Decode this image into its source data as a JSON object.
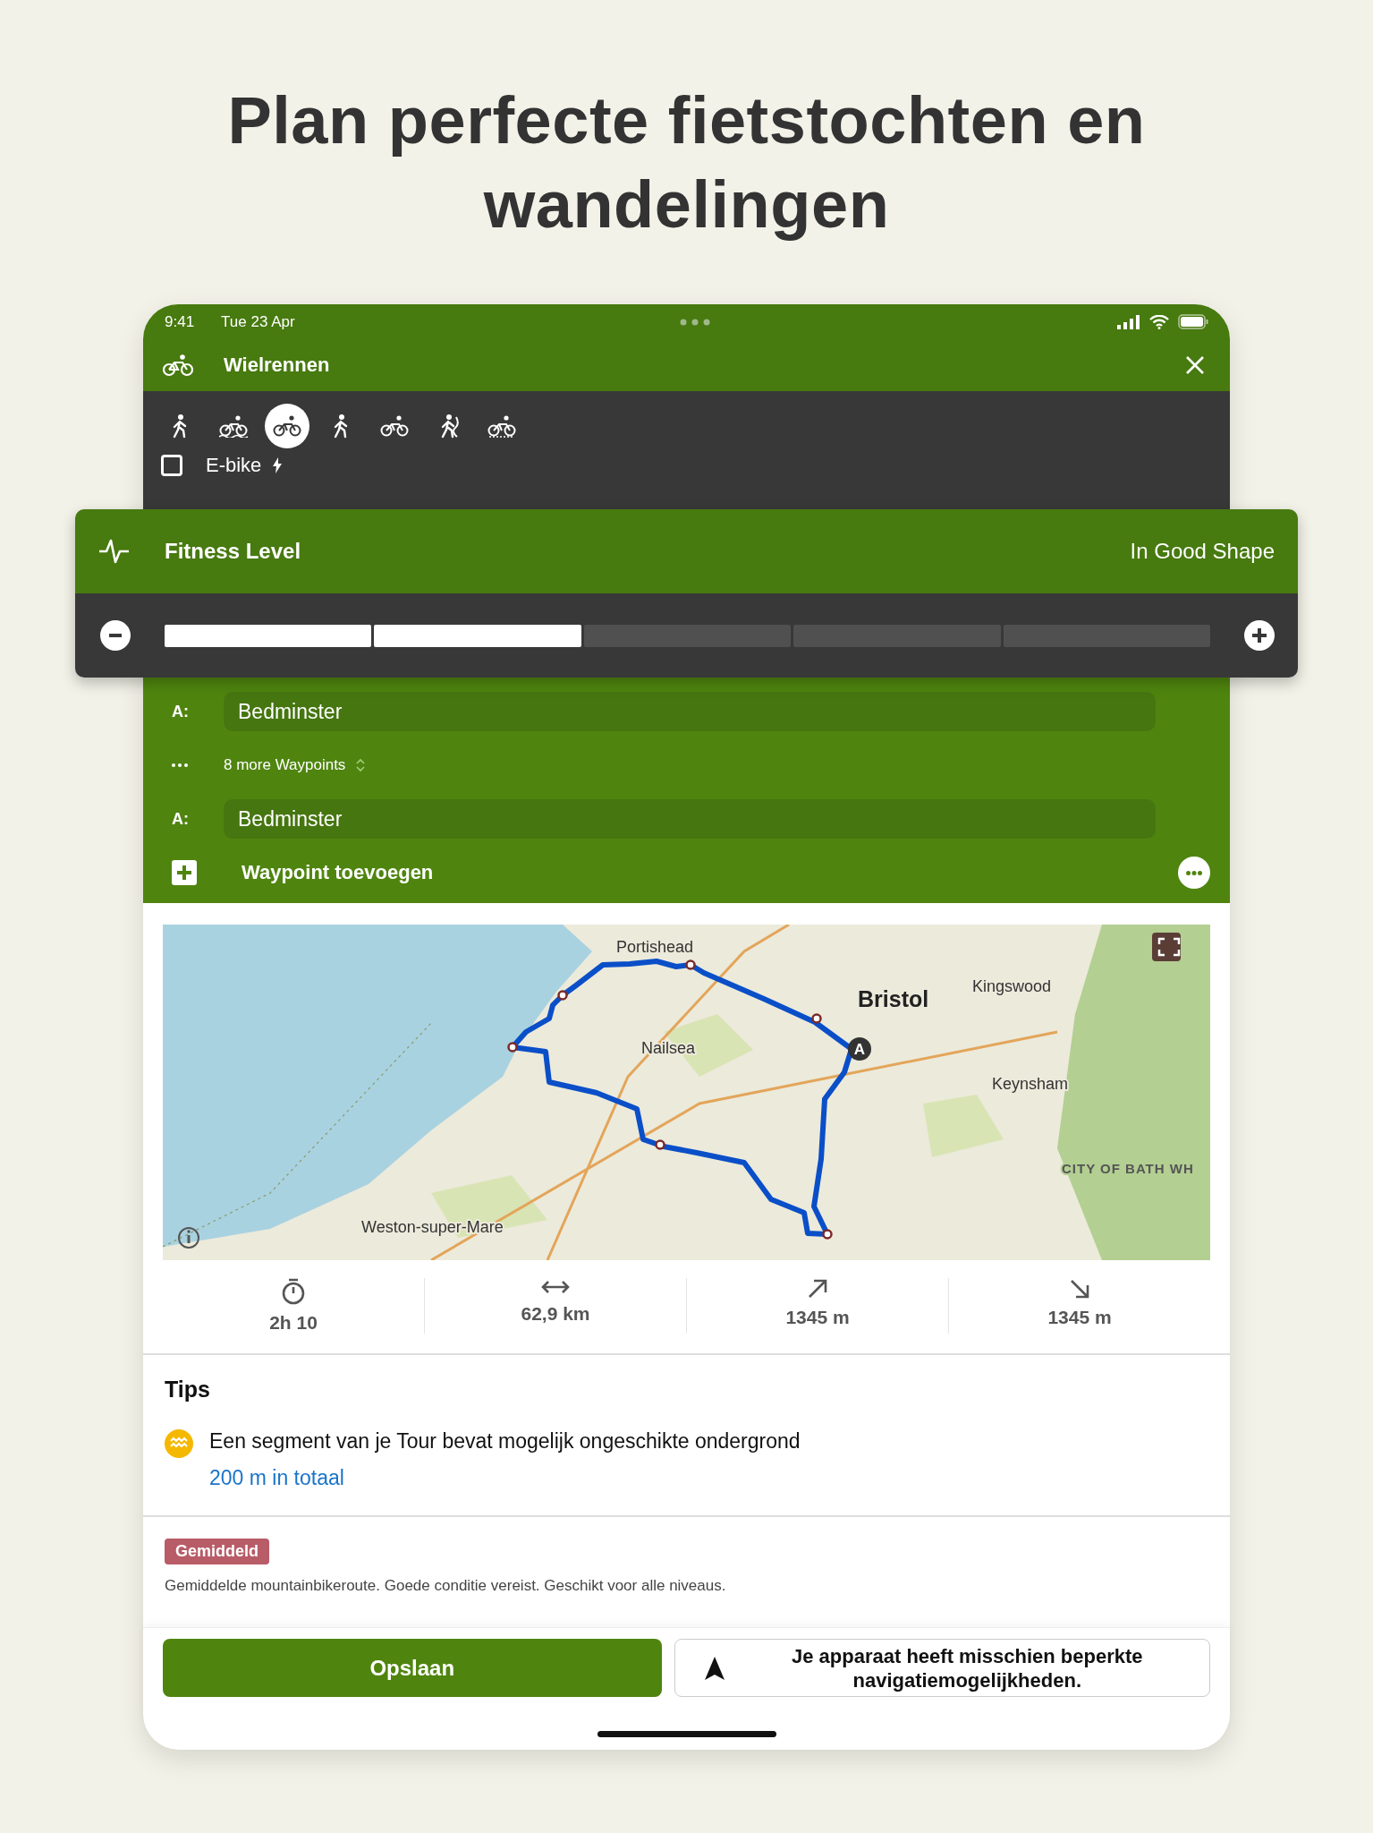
{
  "headline": "Plan perfecte fietstochten en wandelingen",
  "status_bar": {
    "time": "9:41",
    "date": "Tue 23 Apr"
  },
  "header": {
    "title": "Wielrennen"
  },
  "sports": [
    {
      "kind": "hiking",
      "selected": false
    },
    {
      "kind": "mtb",
      "selected": false
    },
    {
      "kind": "road",
      "selected": true
    },
    {
      "kind": "running",
      "selected": false
    },
    {
      "kind": "touring",
      "selected": false
    },
    {
      "kind": "mountaineering",
      "selected": false
    },
    {
      "kind": "gravel",
      "selected": false
    }
  ],
  "ebike": {
    "label": "E-bike",
    "checked": false
  },
  "fitness": {
    "title": "Fitness Level",
    "value": "In Good Shape",
    "level": 0.4
  },
  "waypoints": [
    {
      "kind": "stop",
      "label": "A:",
      "value": "Bedminster"
    },
    {
      "kind": "more",
      "value": "8 more Waypoints"
    },
    {
      "kind": "stop",
      "label": "A:",
      "value": "Bedminster"
    }
  ],
  "add_waypoint": "Waypoint toevoegen",
  "map": {
    "marker": "A",
    "labels": [
      {
        "kind": "town",
        "text": "Portishead"
      },
      {
        "kind": "city",
        "text": "Bristol"
      },
      {
        "kind": "town",
        "text": "Kingswood"
      },
      {
        "kind": "town",
        "text": "Nailsea"
      },
      {
        "kind": "town",
        "text": "Keynsham"
      },
      {
        "kind": "region",
        "text": "CITY OF BATH WH"
      },
      {
        "kind": "town",
        "text": "Weston-super-Mare"
      }
    ]
  },
  "stats": [
    {
      "kind": "duration",
      "value": "2h 10"
    },
    {
      "kind": "distance",
      "value": "62,9 km"
    },
    {
      "kind": "ascent",
      "value": "1345 m"
    },
    {
      "kind": "descent",
      "value": "1345 m"
    }
  ],
  "tips": {
    "title": "Tips",
    "items": [
      {
        "text": "Een segment van je Tour bevat mogelijk ongeschikte ondergrond",
        "link": "200 m in totaal"
      }
    ]
  },
  "difficulty": {
    "badge": "Gemiddeld",
    "description": "Gemiddelde mountainbikeroute. Goede conditie vereist. Geschikt voor alle niveaus."
  },
  "actions": {
    "save": "Opslaan",
    "notice": "Je apparaat heeft misschien beperkte navigatiemogelijkheden."
  }
}
